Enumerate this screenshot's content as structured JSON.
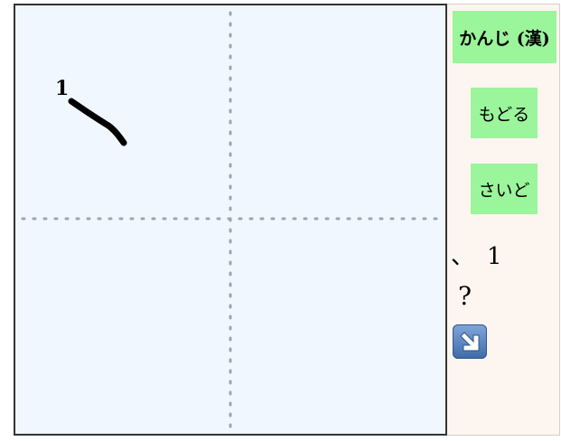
{
  "canvas": {
    "stroke_number": "1",
    "background_color": "#f0f7ff",
    "guide_color": "#9aa6b0",
    "stroke_color": "#000000"
  },
  "side_panel": {
    "kanji_button": "かんじ (漢)",
    "back_button": "もどる",
    "redo_button": "さいど",
    "result_stroke": "、",
    "result_count": "1",
    "question": "?",
    "next_icon": "arrow-down-right-icon",
    "button_color": "#9bf59b"
  }
}
